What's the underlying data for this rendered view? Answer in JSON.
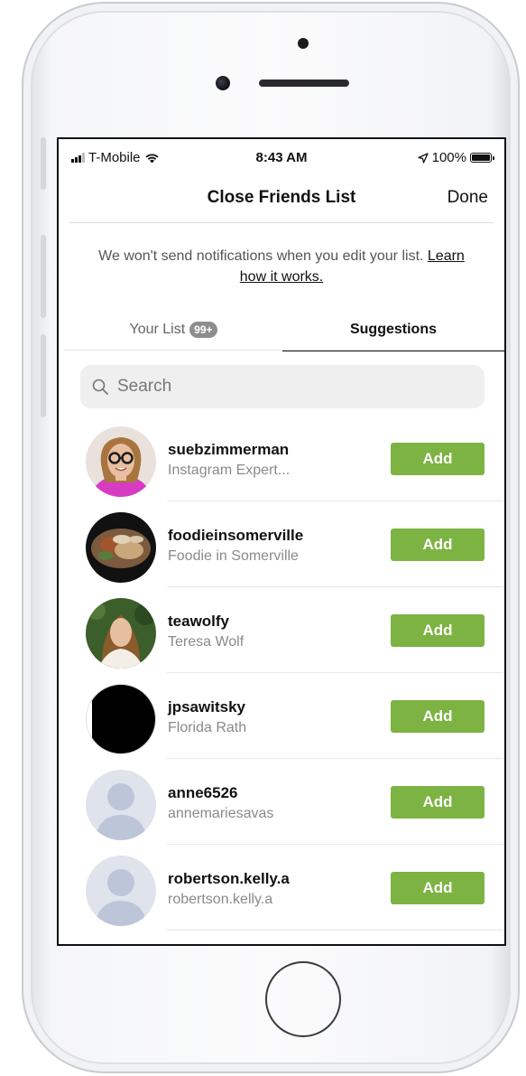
{
  "status_bar": {
    "carrier": "T-Mobile",
    "time": "8:43 AM",
    "battery": "100%"
  },
  "nav": {
    "title": "Close Friends List",
    "done_label": "Done"
  },
  "notice": {
    "text": "We won't send notifications when you edit your list.",
    "link": "Learn how it works."
  },
  "tabs": {
    "your_list_label": "Your List",
    "your_list_count": "99+",
    "suggestions_label": "Suggestions"
  },
  "search": {
    "placeholder": "Search"
  },
  "add_label": "Add",
  "suggestions": [
    {
      "username": "suebzimmerman",
      "full_name": "Instagram Expert...",
      "avatar": "photo-woman-glasses"
    },
    {
      "username": "foodieinsomerville",
      "full_name": "Foodie in Somerville",
      "avatar": "photo-food"
    },
    {
      "username": "teawolfy",
      "full_name": "Teresa Wolf",
      "avatar": "photo-woman-outdoors"
    },
    {
      "username": "jpsawitsky",
      "full_name": "Florida Rath",
      "avatar": "photo-black"
    },
    {
      "username": "anne6526",
      "full_name": "annemariesavas",
      "avatar": "default-avatar-icon"
    },
    {
      "username": "robertson.kelly.a",
      "full_name": "robertson.kelly.a",
      "avatar": "default-avatar-icon"
    }
  ],
  "colors": {
    "add_button": "#7cb342",
    "badge": "#8e8e8e"
  }
}
